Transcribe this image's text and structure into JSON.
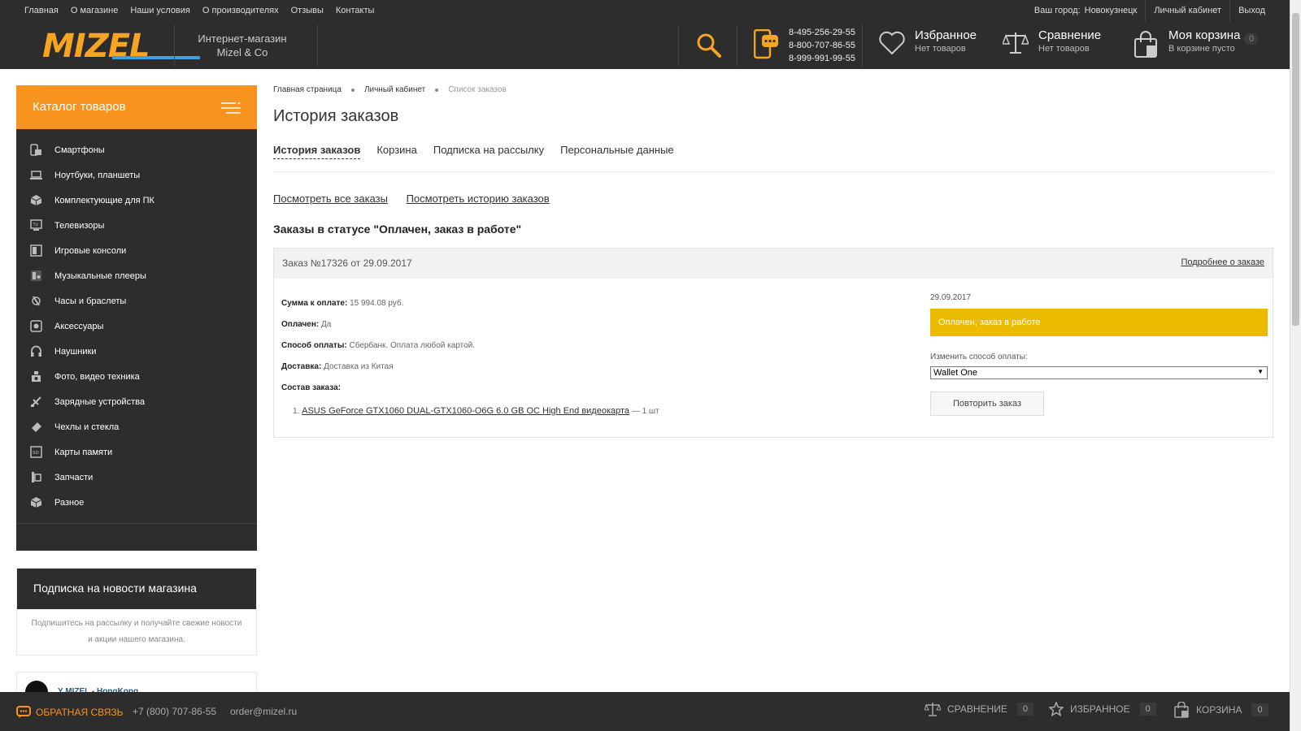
{
  "topbar": {
    "nav": [
      "Главная",
      "О магазине",
      "Наши условия",
      "О производителях",
      "Отзывы",
      "Контакты"
    ],
    "city_label": "Ваш город:",
    "city": "Новокузнецк",
    "account": "Личный кабинет",
    "logout": "Выход"
  },
  "header": {
    "logo": "MIZEL",
    "tagline_1": "Интернет-магазин",
    "tagline_2": "Mizel & Co",
    "phones": [
      "8-495-256-29-55",
      "8-800-707-86-55",
      "8-999-991-99-55"
    ],
    "favorites_title": "Избранное",
    "favorites_sub": "Нет товаров",
    "compare_title": "Сравнение",
    "compare_sub": "Нет товаров",
    "cart_title": "Моя корзина",
    "cart_sub": "В корзине пусто",
    "cart_count": "0"
  },
  "catalog": {
    "title": "Каталог товаров",
    "items": [
      {
        "label": "Смартфоны",
        "icon": "smartphone-icon"
      },
      {
        "label": "Ноутбуки, планшеты",
        "icon": "laptop-icon"
      },
      {
        "label": "Комплектующие для ПК",
        "icon": "cube-icon"
      },
      {
        "label": "Телевизоры",
        "icon": "tv-icon"
      },
      {
        "label": "Игровые консоли",
        "icon": "console-icon"
      },
      {
        "label": "Музыкальные плееры",
        "icon": "player-icon"
      },
      {
        "label": "Часы и браслеты",
        "icon": "watch-icon"
      },
      {
        "label": "Аксессуары",
        "icon": "accessory-icon"
      },
      {
        "label": "Наушники",
        "icon": "headphones-icon"
      },
      {
        "label": "Фото, видео техника",
        "icon": "camera-icon"
      },
      {
        "label": "Зарядные устройства",
        "icon": "charger-icon"
      },
      {
        "label": "Чехлы и стекла",
        "icon": "case-icon"
      },
      {
        "label": "Карты памяти",
        "icon": "sdcard-icon"
      },
      {
        "label": "Запчасти",
        "icon": "parts-icon"
      },
      {
        "label": "Разное",
        "icon": "misc-icon"
      }
    ]
  },
  "subscribe": {
    "title": "Подписка на новости магазина",
    "text_1": "Подпишитесь на рассылку и получайте свежие новости",
    "text_2": "и акции нашего магазина."
  },
  "vk": {
    "name": "Y MIZEL - HongKong"
  },
  "breadcrumbs": [
    "Главная страница",
    "Личный кабинет",
    "Список заказов"
  ],
  "page_title": "История заказов",
  "tabs": [
    "История заказов",
    "Корзина",
    "Подписка на рассылку",
    "Персональные данные"
  ],
  "links": [
    "Посмотреть все заказы",
    "Посмотреть историю заказов"
  ],
  "section_title": "Заказы в статусе \"Оплачен, заказ в работе\"",
  "order": {
    "header": "Заказ №17326 от 29.09.2017",
    "details_link": "Подробнее о заказе",
    "sum_label": "Сумма к оплате:",
    "sum_value": "15 994.08 руб.",
    "paid_label": "Оплачен:",
    "paid_value": "Да",
    "payment_label": "Способ оплаты:",
    "payment_value": "Сбербанк. Оплата любой картой.",
    "delivery_label": "Доставка:",
    "delivery_value": "Доставка из Китая",
    "items_label": "Состав заказа:",
    "item_num": "1.",
    "item_name": "ASUS GeForce GTX1060 DUAL-GTX1060-O6G 6.0 GB OC High End видеокарта",
    "item_qty": "— 1 шт",
    "date": "29.09.2017",
    "status": "Оплачен, заказ в работе",
    "status_color": "#ebbb00",
    "change_label": "Изменить способ оплаты:",
    "payment_select": "Wallet One",
    "repeat_button": "Повторить заказ"
  },
  "footer": {
    "feedback": "ОБРАТНАЯ СВЯЗЬ",
    "phone": "+7 (800) 707-86-55",
    "email": "order@mizel.ru",
    "compare": "СРАВНЕНИЕ",
    "compare_count": "0",
    "favorites": "ИЗБРАННОЕ",
    "favorites_count": "0",
    "cart": "КОРЗИНА",
    "cart_count": "0"
  },
  "colors": {
    "accent": "#f7931e",
    "dark": "#2d2d2d",
    "status": "#ebbb00"
  }
}
